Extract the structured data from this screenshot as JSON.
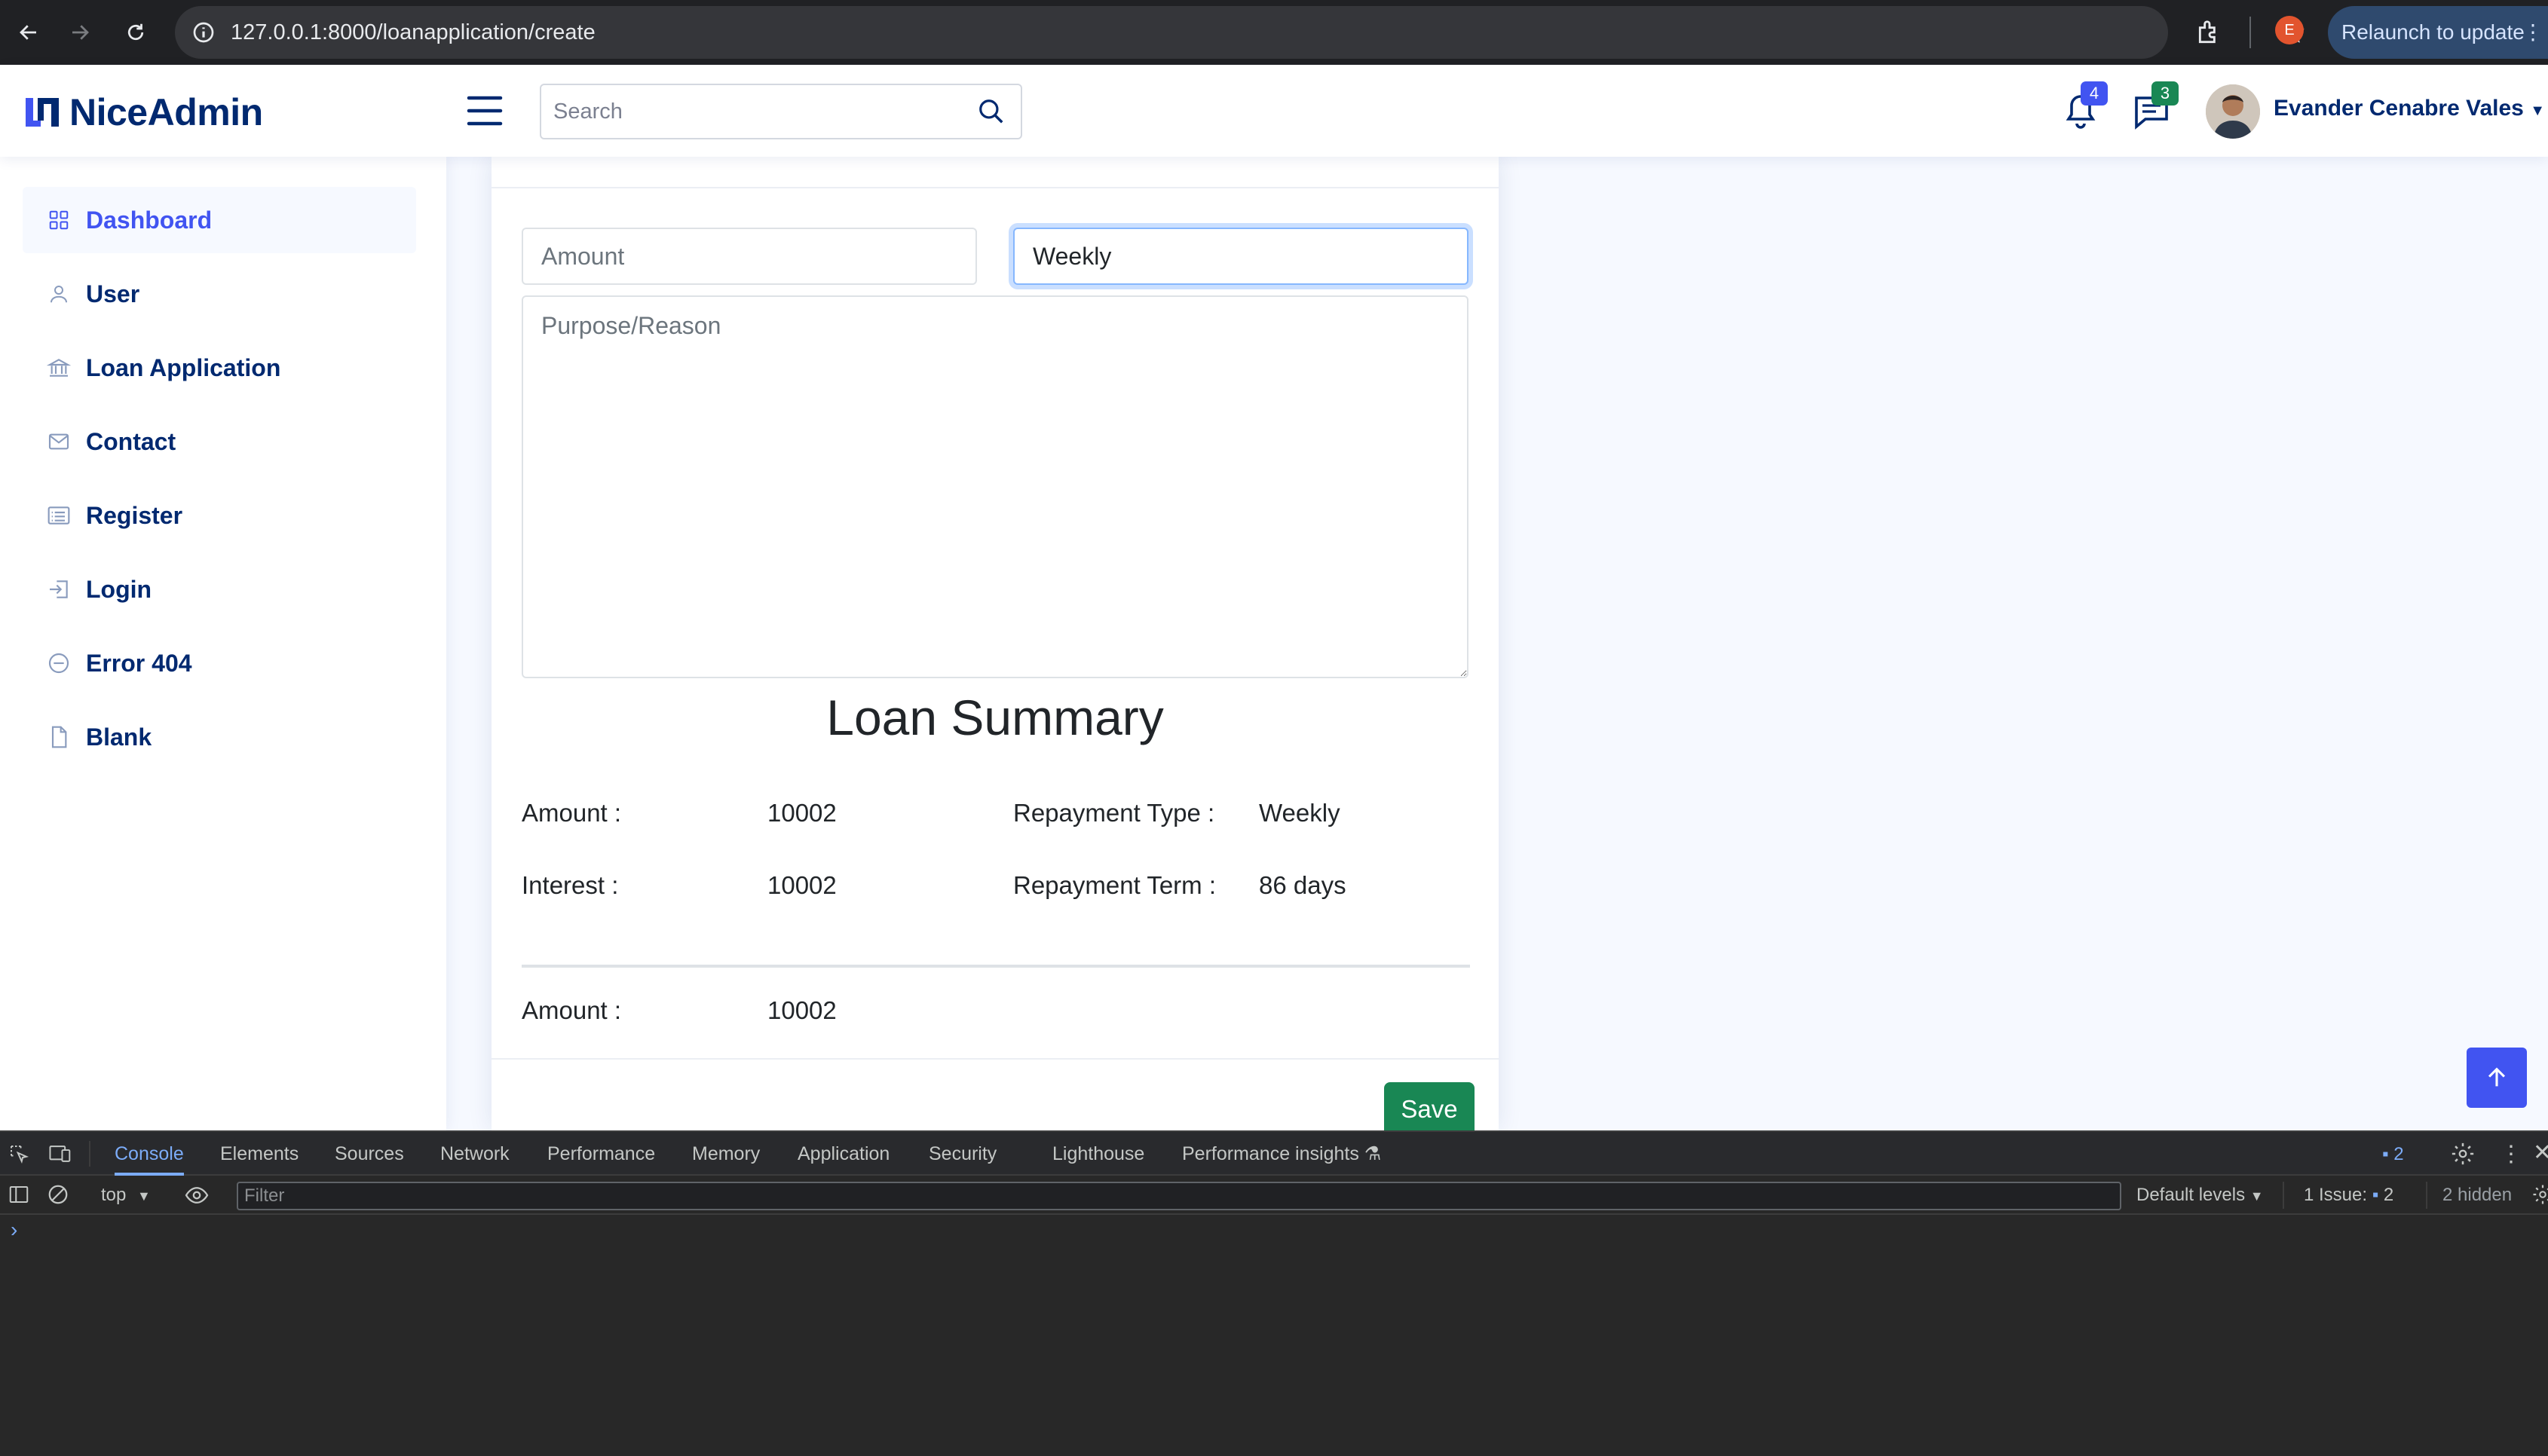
{
  "browser": {
    "url": "127.0.0.1:8000/loanapplication/create",
    "profile_initial": "E",
    "relaunch_label": "Relaunch to update"
  },
  "header": {
    "brand": "NiceAdmin",
    "search_placeholder": "Search",
    "notifications_count": "4",
    "messages_count": "3",
    "user_name": "Evander Cenabre Vales",
    "colors": {
      "brand": "#012970",
      "accent": "#4154f1",
      "notif_badge": "#4154f1",
      "msg_badge": "#198754"
    }
  },
  "sidebar": {
    "items": [
      {
        "label": "Dashboard",
        "icon": "grid-icon",
        "active": true
      },
      {
        "label": "User",
        "icon": "person-icon"
      },
      {
        "label": "Loan Application",
        "icon": "bank-icon"
      },
      {
        "label": "Contact",
        "icon": "envelope-icon"
      },
      {
        "label": "Register",
        "icon": "card-list-icon"
      },
      {
        "label": "Login",
        "icon": "box-arrow-in-right-icon"
      },
      {
        "label": "Error 404",
        "icon": "dash-circle-icon"
      },
      {
        "label": "Blank",
        "icon": "file-icon"
      }
    ]
  },
  "form": {
    "amount_placeholder": "Amount",
    "repayment_value": "Weekly",
    "purpose_placeholder": "Purpose/Reason"
  },
  "summary": {
    "title": "Loan Summary",
    "amount_label": "Amount :",
    "amount_value": "10002",
    "repayment_type_label": "Repayment Type :",
    "repayment_type_value": "Weekly",
    "interest_label": "Interest :",
    "interest_value": "10002",
    "repayment_term_label": "Repayment Term :",
    "repayment_term_value": "86 days",
    "total_label": "Amount :",
    "total_value": "10002"
  },
  "actions": {
    "save_label": "Save"
  },
  "devtools": {
    "tabs": [
      "Console",
      "Elements",
      "Sources",
      "Network",
      "Performance",
      "Memory",
      "Application",
      "Security",
      "Lighthouse",
      "Performance insights"
    ],
    "active_tab": "Console",
    "messages_count": "2",
    "context": "top",
    "filter_placeholder": "Filter",
    "levels": "Default levels",
    "issues_label": "1 Issue:",
    "issues_count": "2",
    "hidden_label": "2 hidden",
    "prompt": "›"
  }
}
